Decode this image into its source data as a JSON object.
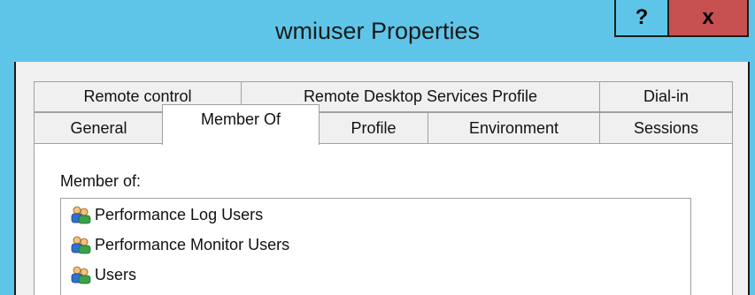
{
  "window": {
    "title": "wmiuser Properties",
    "help_label": "?",
    "close_label": "x"
  },
  "tabs_row1": [
    {
      "label": "Remote control"
    },
    {
      "label": "Remote Desktop Services Profile"
    },
    {
      "label": "Dial-in"
    }
  ],
  "tabs_row2": [
    {
      "label": "General"
    },
    {
      "label": "Member Of",
      "selected": true
    },
    {
      "label": "Profile"
    },
    {
      "label": "Environment"
    },
    {
      "label": "Sessions"
    }
  ],
  "member_of": {
    "label": "Member of:",
    "columns": [],
    "items": [
      {
        "name": "Performance Log Users",
        "icon": "group-icon"
      },
      {
        "name": "Performance Monitor Users",
        "icon": "group-icon"
      },
      {
        "name": "Users",
        "icon": "group-icon"
      }
    ]
  },
  "colors": {
    "titlebar": "#5fc5e8",
    "close_button": "#c75050",
    "dialog_bg": "#f0f0f0"
  }
}
